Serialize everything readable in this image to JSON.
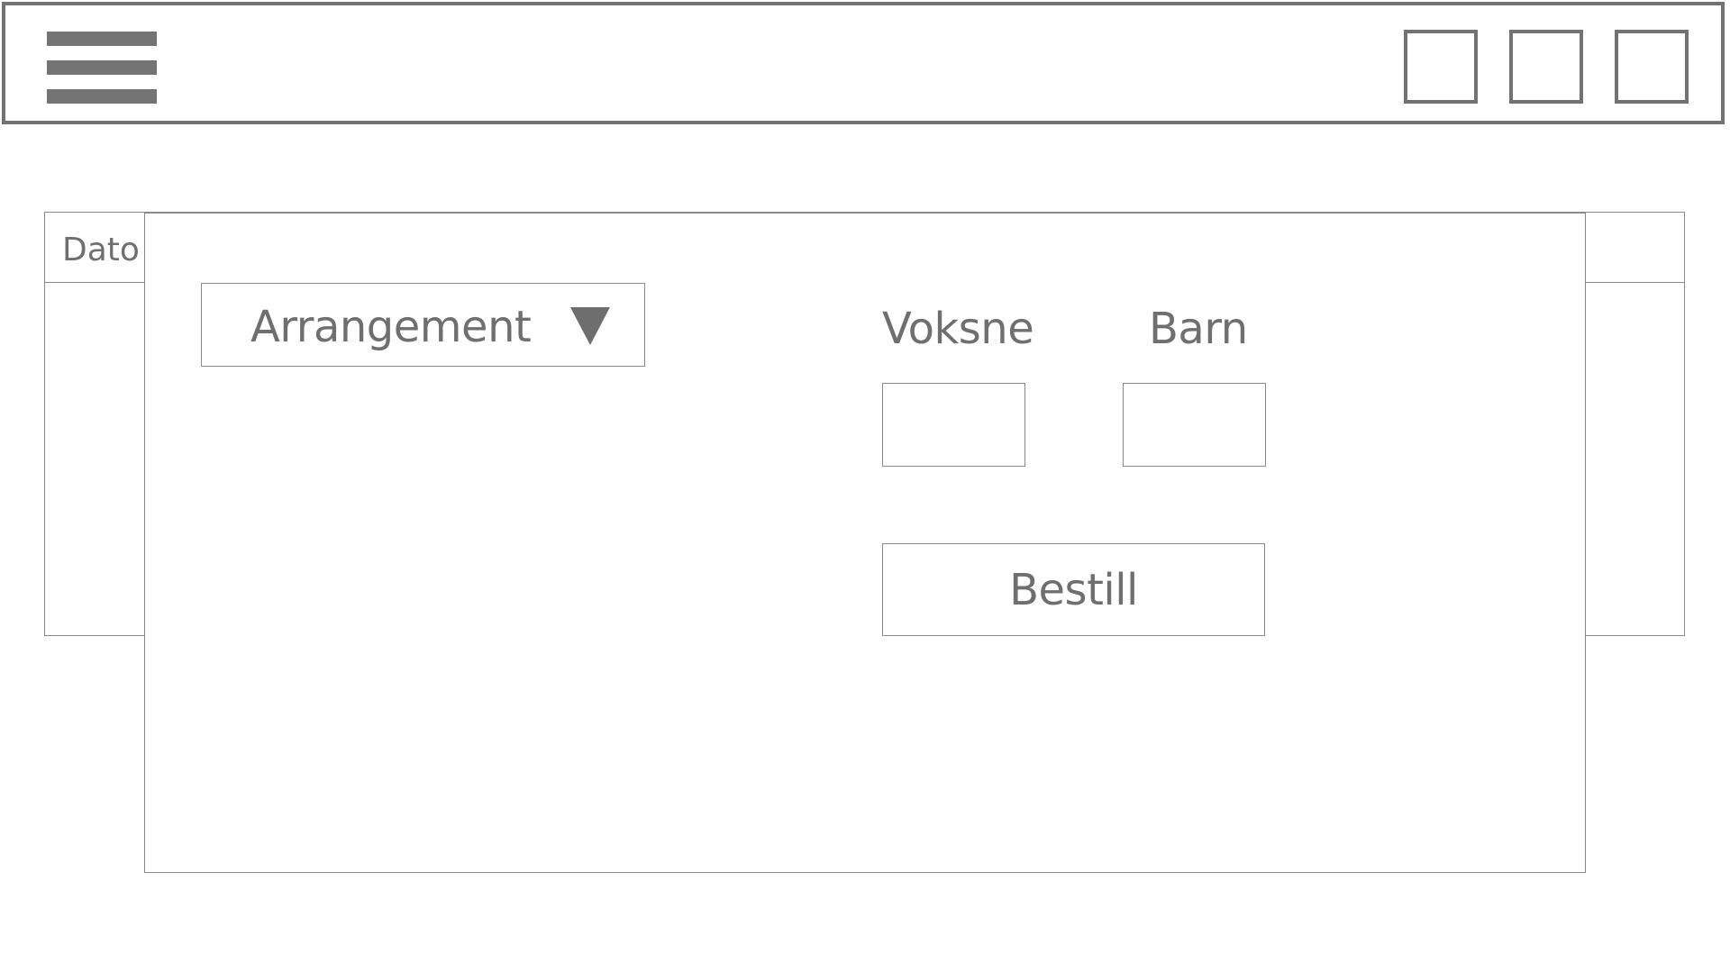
{
  "header": {
    "menu_icon": "hamburger-menu-icon",
    "window_buttons": [
      "placeholder-square",
      "placeholder-square",
      "placeholder-square"
    ]
  },
  "background_table": {
    "column_header": "Dato"
  },
  "modal": {
    "dropdown": {
      "selected_label": "Arrangement",
      "icon": "triangle-down-icon"
    },
    "adults": {
      "label": "Voksne",
      "value": ""
    },
    "children": {
      "label": "Barn",
      "value": ""
    },
    "order_button_label": "Bestill"
  },
  "colors": {
    "stroke": "#727272",
    "text": "#6f6f6f",
    "background": "#ffffff"
  }
}
